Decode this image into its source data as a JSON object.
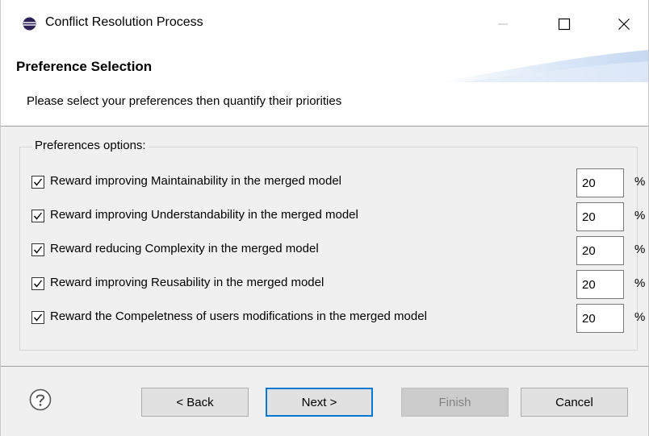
{
  "window": {
    "title": "Conflict Resolution Process",
    "icon": "eclipse-icon"
  },
  "header": {
    "title": "Preference Selection",
    "subtitle": "Please select your preferences then quantify their priorities"
  },
  "preferences": {
    "group_label": "Preferences options:",
    "percent_symbol": "%",
    "items": [
      {
        "label": "Reward improving Maintainability in the merged model",
        "checked": true,
        "value": "20"
      },
      {
        "label": "Reward improving Understandability in the merged model",
        "checked": true,
        "value": "20"
      },
      {
        "label": "Reward reducing Complexity in the merged model",
        "checked": true,
        "value": "20"
      },
      {
        "label": "Reward improving Reusability in the merged model",
        "checked": true,
        "value": "20"
      },
      {
        "label": "Reward the Compeletness of users modifications in the merged model",
        "checked": true,
        "value": "20"
      }
    ]
  },
  "footer": {
    "help_icon": "help-icon",
    "back_label": "< Back",
    "next_label": "Next >",
    "finish_label": "Finish",
    "cancel_label": "Cancel"
  },
  "colors": {
    "accent": "#0078d7",
    "window_bg": "#f0f0f0",
    "banner_bg": "#ffffff",
    "swoosh": "#d6e4f5"
  }
}
